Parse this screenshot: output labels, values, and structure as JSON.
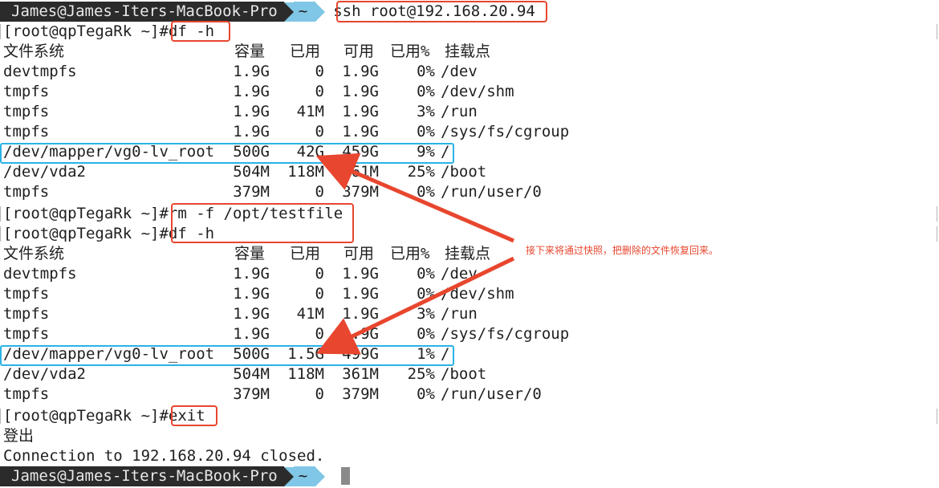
{
  "prompt": {
    "user_host": "James@James-Iters-MacBook-Pro",
    "dir": "~",
    "command": "ssh root@192.168.20.94"
  },
  "remote_prompt": "[root@qpTegaRk ~]#",
  "commands": {
    "df1": "df -h",
    "rm": "rm -f /opt/testfile",
    "df2": "df -h",
    "exit": "exit"
  },
  "df_header": {
    "filesystem": "文件系统",
    "size": "容量",
    "used": "已用",
    "avail": "可用",
    "use_pct": "已用%",
    "mount": "挂载点"
  },
  "df_before": [
    [
      "devtmpfs",
      "1.9G",
      "0",
      "1.9G",
      "0%",
      "/dev"
    ],
    [
      "tmpfs",
      "1.9G",
      "0",
      "1.9G",
      "0%",
      "/dev/shm"
    ],
    [
      "tmpfs",
      "1.9G",
      "41M",
      "1.9G",
      "3%",
      "/run"
    ],
    [
      "tmpfs",
      "1.9G",
      "0",
      "1.9G",
      "0%",
      "/sys/fs/cgroup"
    ],
    [
      "/dev/mapper/vg0-lv_root",
      "500G",
      "42G",
      "459G",
      "9%",
      "/"
    ],
    [
      "/dev/vda2",
      "504M",
      "118M",
      "361M",
      "25%",
      "/boot"
    ],
    [
      "tmpfs",
      "379M",
      "0",
      "379M",
      "0%",
      "/run/user/0"
    ]
  ],
  "df_after": [
    [
      "devtmpfs",
      "1.9G",
      "0",
      "1.9G",
      "0%",
      "/dev"
    ],
    [
      "tmpfs",
      "1.9G",
      "0",
      "1.9G",
      "0%",
      "/dev/shm"
    ],
    [
      "tmpfs",
      "1.9G",
      "41M",
      "1.9G",
      "3%",
      "/run"
    ],
    [
      "tmpfs",
      "1.9G",
      "0",
      "1.9G",
      "0%",
      "/sys/fs/cgroup"
    ],
    [
      "/dev/mapper/vg0-lv_root",
      "500G",
      "1.5G",
      "499G",
      "1%",
      "/"
    ],
    [
      "/dev/vda2",
      "504M",
      "118M",
      "361M",
      "25%",
      "/boot"
    ],
    [
      "tmpfs",
      "379M",
      "0",
      "379M",
      "0%",
      "/run/user/0"
    ]
  ],
  "logout": "登出",
  "closed": "Connection to 192.168.20.94 closed.",
  "annotation": "接下来将通过快照，把删除的文件恢复回来。",
  "colors": {
    "red_highlight": "#e8462e",
    "blue_highlight": "#2ab3e6",
    "prompt_dark": "#2b2b2b",
    "prompt_blue": "#80c6e6"
  }
}
